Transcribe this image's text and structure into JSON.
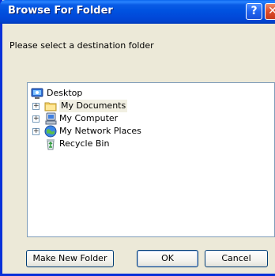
{
  "dialog": {
    "title": "Browse For Folder",
    "help_glyph": "?",
    "close_glyph": "✕",
    "prompt": "Please select a destination folder"
  },
  "tree": {
    "items": [
      {
        "label": "Desktop",
        "icon": "desktop-icon",
        "expander": ""
      },
      {
        "label": "My Documents",
        "icon": "folder-icon",
        "expander": "+",
        "selected": true
      },
      {
        "label": "My Computer",
        "icon": "computer-icon",
        "expander": "+"
      },
      {
        "label": "My Network Places",
        "icon": "network-places-icon",
        "expander": "+"
      },
      {
        "label": "Recycle Bin",
        "icon": "recycle-bin-icon",
        "expander": ""
      }
    ]
  },
  "buttons": {
    "new_folder": "Make New Folder",
    "ok": "OK",
    "cancel": "Cancel"
  },
  "colors": {
    "titlebar": "#0052e0",
    "dialog_bg": "#ece9d8",
    "tree_border": "#7f9db9",
    "button_border": "#003c74"
  }
}
